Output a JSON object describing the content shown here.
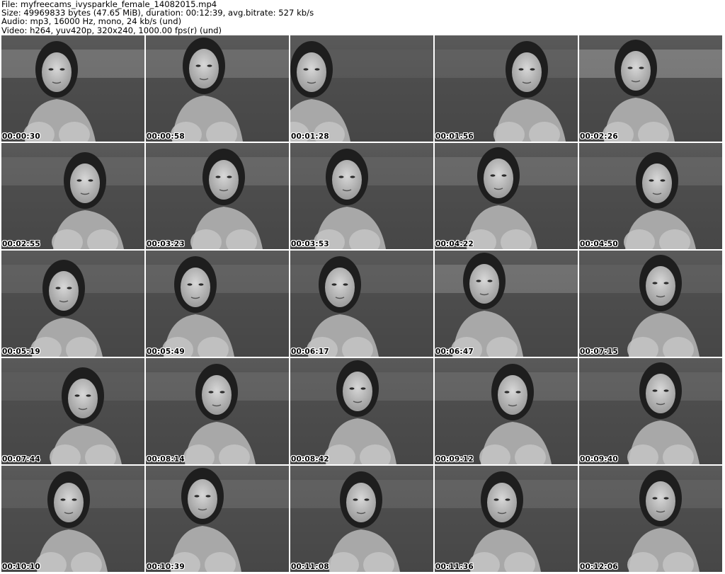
{
  "header": {
    "file_line": "File: myfreecams_ivysparkle_female_14082015.mp4",
    "size_line": "Size: 49969833 bytes (47.65 MiB), duration: 00:12:39, avg.bitrate: 527 kb/s",
    "audio_line": "Audio: mp3, 16000 Hz, mono, 24 kb/s (und)",
    "video_line": "Video: h264, yuv420p, 320x240, 1000.00 fps(r) (und)"
  },
  "thumbnails": [
    {
      "timestamp": "00:00:30"
    },
    {
      "timestamp": "00:00:58"
    },
    {
      "timestamp": "00:01:28"
    },
    {
      "timestamp": "00:01:56"
    },
    {
      "timestamp": "00:02:26"
    },
    {
      "timestamp": "00:02:55"
    },
    {
      "timestamp": "00:03:23"
    },
    {
      "timestamp": "00:03:53"
    },
    {
      "timestamp": "00:04:22"
    },
    {
      "timestamp": "00:04:50"
    },
    {
      "timestamp": "00:05:19"
    },
    {
      "timestamp": "00:05:49"
    },
    {
      "timestamp": "00:06:17"
    },
    {
      "timestamp": "00:06:47"
    },
    {
      "timestamp": "00:07:15"
    },
    {
      "timestamp": "00:07:44"
    },
    {
      "timestamp": "00:08:14"
    },
    {
      "timestamp": "00:08:42"
    },
    {
      "timestamp": "00:09:12"
    },
    {
      "timestamp": "00:09:40"
    },
    {
      "timestamp": "00:10:10"
    },
    {
      "timestamp": "00:10:39"
    },
    {
      "timestamp": "00:11:08"
    },
    {
      "timestamp": "00:11:36"
    },
    {
      "timestamp": "00:12:06"
    }
  ]
}
